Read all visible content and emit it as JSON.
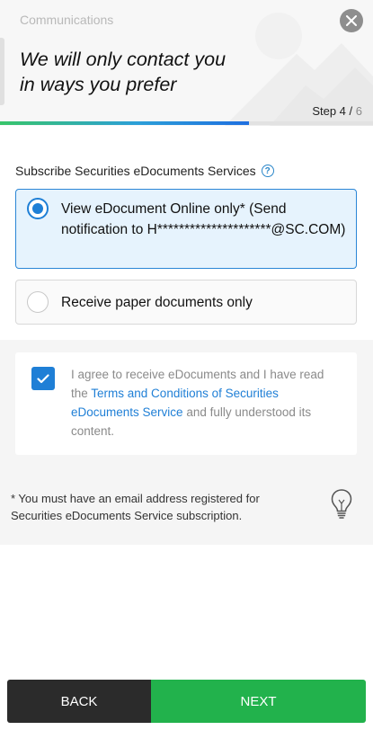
{
  "header": {
    "section_title": "Communications",
    "headline_line1": "We will only contact you",
    "headline_line2": "in ways you prefer",
    "step_current": "Step 4",
    "step_separator": " / ",
    "step_total": "6",
    "progress_fraction": 0.667,
    "close_icon": "close-icon"
  },
  "subscribe": {
    "label": "Subscribe Securities eDocuments Services",
    "info_icon": "info-icon",
    "options": [
      {
        "label": "View eDocument Online only* (Send notification to H*********************@SC.COM)",
        "selected": true
      },
      {
        "label": "Receive paper documents only",
        "selected": false
      }
    ]
  },
  "agreement": {
    "checked": true,
    "text_before": "I agree to receive eDocuments and I have read the ",
    "link_text": "Terms and Conditions of Securities eDocuments Service",
    "text_after": " and fully understood its content."
  },
  "note": {
    "text": "* You must have an email address registered for Securities eDocuments Service subscription.",
    "icon": "lightbulb-icon"
  },
  "buttons": {
    "back": "BACK",
    "next": "NEXT"
  },
  "colors": {
    "accent_blue": "#1f7fd6",
    "next_green": "#22b24c",
    "back_dark": "#2b2b2b"
  }
}
